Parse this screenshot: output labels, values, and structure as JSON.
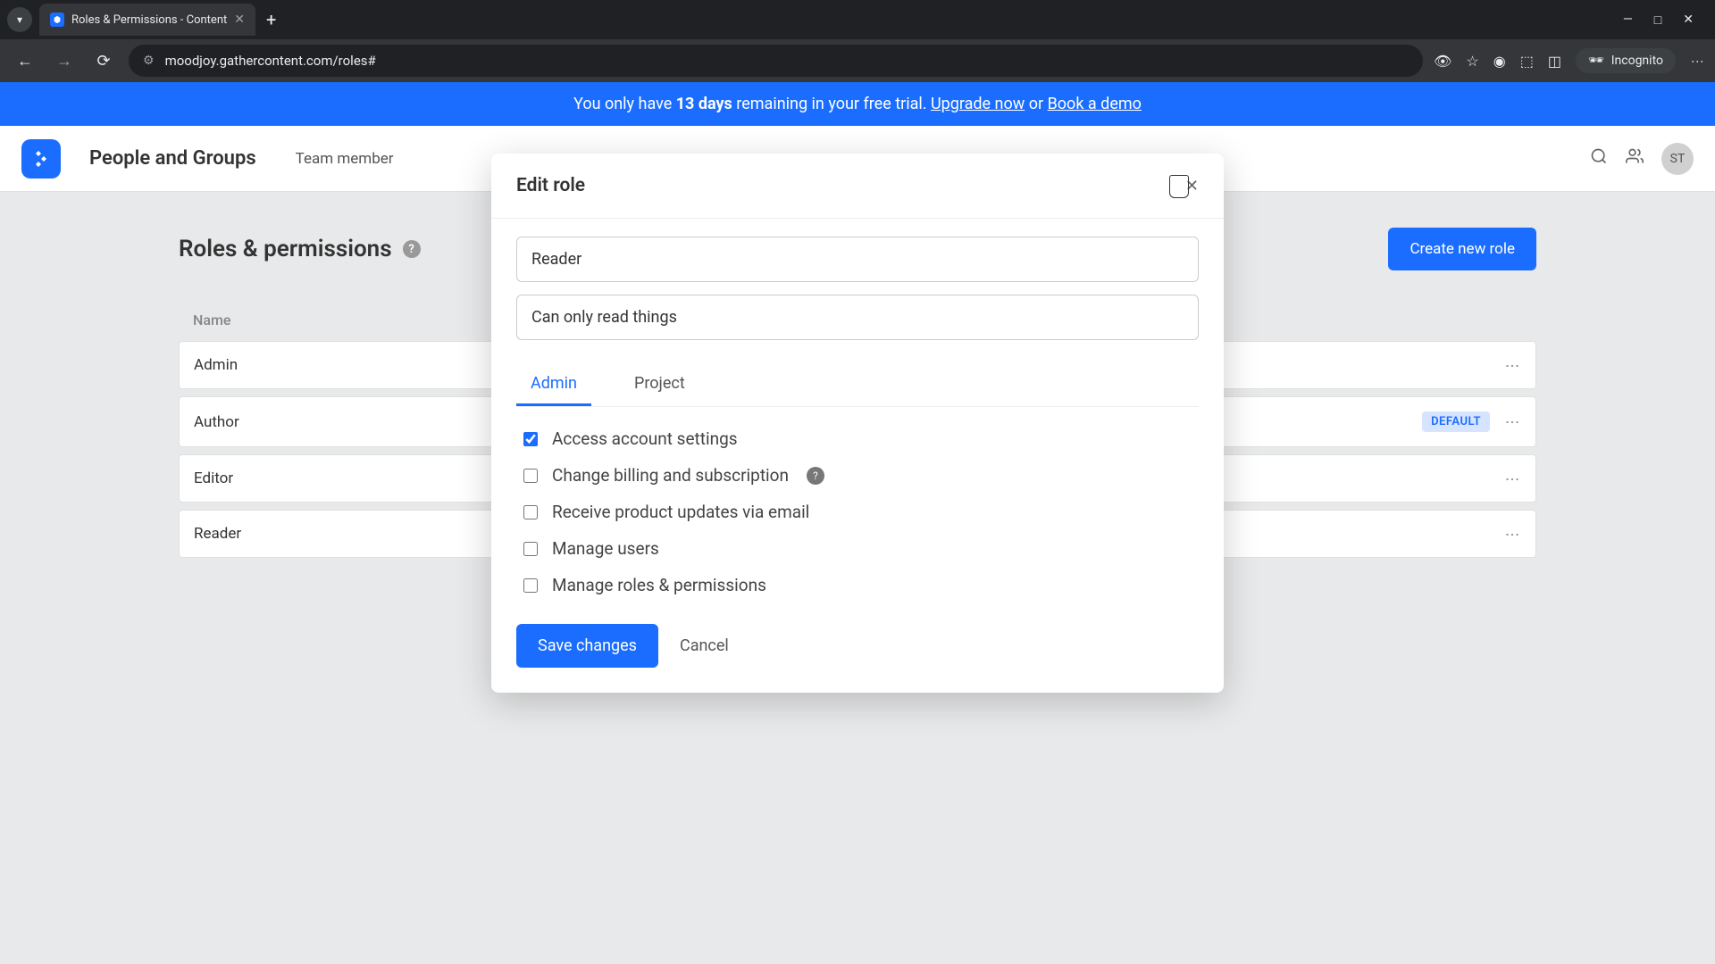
{
  "browser": {
    "tab_title": "Roles & Permissions - Content",
    "url": "moodjoy.gathercontent.com/roles#",
    "incognito_label": "Incognito"
  },
  "trial_banner": {
    "prefix": "You only have ",
    "days": "13 days",
    "middle": " remaining in your free trial. ",
    "upgrade": "Upgrade now",
    "or": " or ",
    "book": "Book a demo"
  },
  "header": {
    "title": "People and Groups",
    "nav_item": "Team member",
    "avatar_initials": "ST"
  },
  "page": {
    "title": "Roles & permissions",
    "create_button": "Create new role",
    "column_name": "Name"
  },
  "roles": [
    {
      "name": "Admin",
      "default": false
    },
    {
      "name": "Author",
      "default": true
    },
    {
      "name": "Editor",
      "default": false
    },
    {
      "name": "Reader",
      "default": false
    }
  ],
  "default_badge": "DEFAULT",
  "modal": {
    "title": "Edit role",
    "name_value": "Reader",
    "description_value": "Can only read things",
    "tabs": {
      "admin": "Admin",
      "project": "Project"
    },
    "permissions": [
      {
        "label": "Access account settings",
        "checked": true,
        "help": false
      },
      {
        "label": "Change billing and subscription",
        "checked": false,
        "help": true
      },
      {
        "label": "Receive product updates via email",
        "checked": false,
        "help": false
      },
      {
        "label": "Manage users",
        "checked": false,
        "help": false
      },
      {
        "label": "Manage roles & permissions",
        "checked": false,
        "help": false
      }
    ],
    "save_label": "Save changes",
    "cancel_label": "Cancel"
  }
}
